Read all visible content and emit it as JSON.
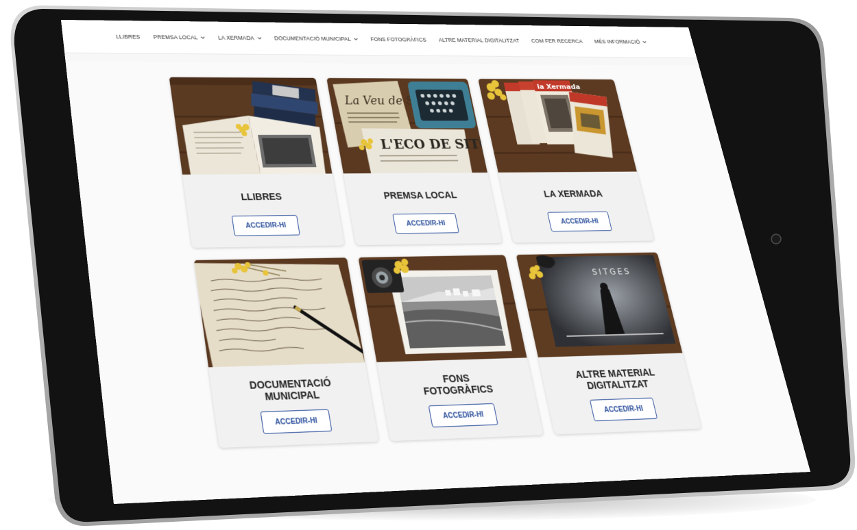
{
  "nav": {
    "items": [
      {
        "label": "LLIBRES",
        "has_dropdown": false
      },
      {
        "label": "PREMSA LOCAL",
        "has_dropdown": true
      },
      {
        "label": "LA XERMADA",
        "has_dropdown": true
      },
      {
        "label": "DOCUMENTACIÓ MUNICIPAL",
        "has_dropdown": true
      },
      {
        "label": "FONS FOTOGRÀFICS",
        "has_dropdown": false
      },
      {
        "label": "ALTRE MATERIAL DIGITALITZAT",
        "has_dropdown": false
      },
      {
        "label": "COM FER RECERCA",
        "has_dropdown": false
      },
      {
        "label": "MÉS INFORMACIÓ",
        "has_dropdown": true
      }
    ]
  },
  "cards": [
    {
      "title": "LLIBRES",
      "button": "ACCEDIR-HI",
      "image": "books-photo"
    },
    {
      "title": "PREMSA LOCAL",
      "button": "ACCEDIR-HI",
      "image": "newspapers-typewriter-photo"
    },
    {
      "title": "LA XERMADA",
      "button": "ACCEDIR-HI",
      "image": "magazines-photo"
    },
    {
      "title": "DOCUMENTACIÓ\nMUNICIPAL",
      "button": "ACCEDIR-HI",
      "image": "manuscript-pen-photo"
    },
    {
      "title": "FONS\nFOTOGRÀFICS",
      "button": "ACCEDIR-HI",
      "image": "camera-old-photo"
    },
    {
      "title": "ALTRE MATERIAL\nDIGITALITZAT",
      "button": "ACCEDIR-HI",
      "image": "festival-poster-photo"
    }
  ],
  "colors": {
    "accent": "#2c4f9c",
    "wood": "#6b4328",
    "flower": "#e8c43a",
    "bezel": "#121212"
  }
}
